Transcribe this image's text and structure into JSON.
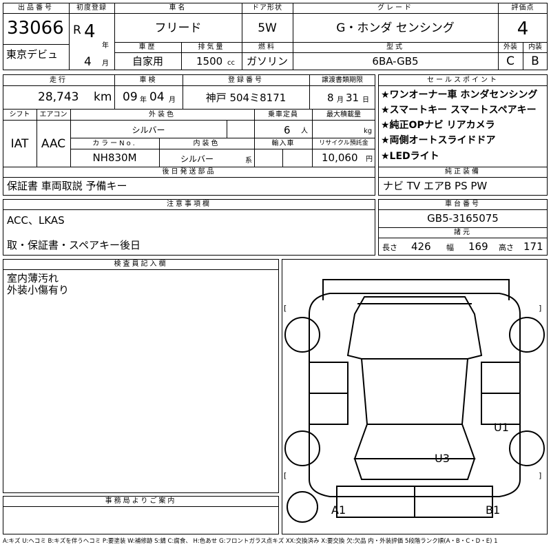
{
  "top": {
    "lot_no_header": "出品番号",
    "lot_no": "33066",
    "first_reg_header": "初度登録",
    "era": "R",
    "reg_year": "4",
    "year_unit": "年",
    "reg_month": "4",
    "month_unit": "月",
    "car_name_header": "車名",
    "car_name": "フリード",
    "door_header": "ドア形状",
    "door": "5W",
    "grade_header": "グレード",
    "grade": "G・ホンダ センシング",
    "score_header": "評価点",
    "score": "4",
    "history_header": "車歴",
    "history": "自家用",
    "displacement_header": "排気量",
    "displacement": "1500",
    "displacement_unit": "cc",
    "fuel_header": "燃料",
    "fuel": "ガソリン",
    "model_header": "型式",
    "model": "6BA-GB5",
    "exterior_header": "外装",
    "exterior_grade": "C",
    "interior_header": "内装",
    "interior_grade": "B",
    "debut": "東京デビュ"
  },
  "info": {
    "mileage_header": "走行",
    "mileage": "28,743",
    "mileage_unit": "km",
    "inspection_header": "車検",
    "insp_year": "09",
    "insp_year_unit": "年",
    "insp_month": "04",
    "insp_month_unit": "月",
    "plate_header": "登録番号",
    "plate": "神戸 504ミ8171",
    "transfer_header": "譲渡書類期限",
    "transfer_month": "8",
    "transfer_month_unit": "月",
    "transfer_day": "31",
    "transfer_day_unit": "日",
    "shift_header": "シフト",
    "shift": "IAT",
    "ac_header": "エアコン",
    "ac": "AAC",
    "color_header": "外装色",
    "color": "シルバー",
    "capacity_header": "乗車定員",
    "capacity": "6",
    "capacity_unit": "人",
    "load_header": "最大積載量",
    "load_unit": "kg",
    "color_no_header": "カラーNo.",
    "color_no": "NH830M",
    "interior_color_header": "内装色",
    "interior_color": "シルバー",
    "interior_color_suffix": "系",
    "import_header": "輸入車",
    "recycle_header": "リサイクル預託金",
    "recycle": "10,060",
    "recycle_unit": "円",
    "later_header": "後日発送部品",
    "later": "保証書 車両取説 予備キー"
  },
  "sales": {
    "header": "セールスポイント",
    "points": [
      "★ワンオーナー車 ホンダセンシング",
      "★スマートキー スマートスペアキー",
      "★純正OPナビ リアカメラ",
      "★両側オートスライドドア",
      "★LEDライト"
    ]
  },
  "equipment": {
    "header": "純正装備",
    "value": "ナビ TV エアB PS PW"
  },
  "notes": {
    "header": "注意事項欄",
    "line1": "ACC、LKAS",
    "line2": "取・保証書・スペアキー後日"
  },
  "chassis": {
    "header": "車台番号",
    "value": "GB5-3165075",
    "dims_header": "諸元",
    "length_label": "長さ",
    "length": "426",
    "width_label": "幅",
    "width": "169",
    "height_label": "高さ",
    "height": "171"
  },
  "inspector": {
    "header": "検査員記入欄",
    "line1": "室内薄汚れ",
    "line2": "外装小傷有り"
  },
  "office": {
    "header": "事務局よりご案内"
  },
  "diagram": {
    "marks": [
      {
        "code": "U1"
      },
      {
        "code": "U3"
      },
      {
        "code": "A1"
      },
      {
        "code": "B1"
      }
    ]
  },
  "footer": "A:キズ U:ヘコミ B:キズを伴うヘコミ P:要塗装 W:補修跡 S:錆 C:腐食、 H:色あせ G:フロントガラス点キズ XX:交換済み X:要交換 欠:欠品 内・外装評価 5段階ランク順(A・B・C・D・E) 1"
}
